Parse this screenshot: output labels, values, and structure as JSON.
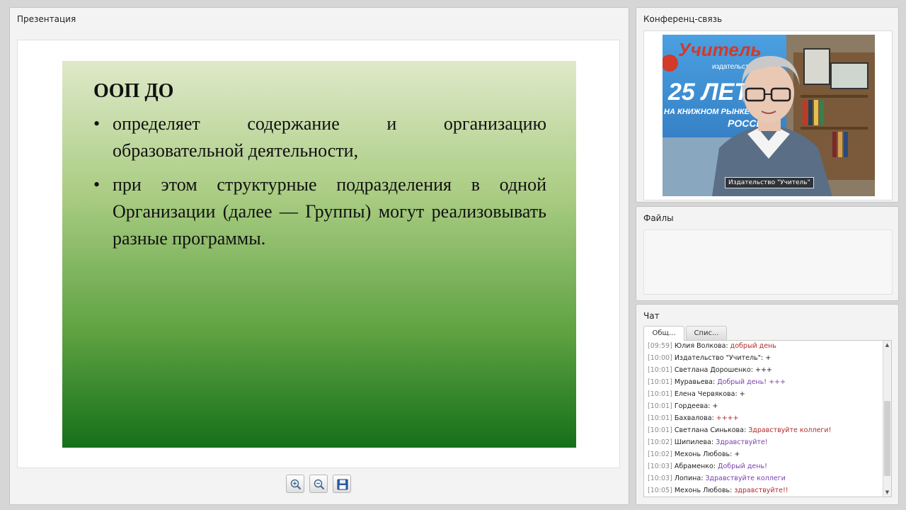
{
  "presentation": {
    "title": "Презентация",
    "slide": {
      "heading": "ООП ДО",
      "bullets": [
        "определяет содержание и организацию образовательной деятельности,",
        "при этом структурные подразделения в одной Организации (далее — Группы) могут реализовывать разные программы."
      ],
      "bullet_glyph": "•"
    },
    "toolbar": {
      "zoom_in": "zoom-in-icon",
      "zoom_out": "zoom-out-icon",
      "save": "save-icon"
    }
  },
  "conference": {
    "title": "Конференц-связь",
    "video_label": "Издательство \"Учитель\"",
    "backdrop_text": [
      "Учитель",
      "издательство",
      "25 ЛЕТ",
      "НА КНИЖНОМ РЫНКЕ",
      "РОССИИ"
    ]
  },
  "files": {
    "title": "Файлы"
  },
  "chat": {
    "title": "Чат",
    "tabs": [
      "Общ...",
      "Спис..."
    ],
    "messages": [
      {
        "time": "[09:59]",
        "author": "Юлия Волкова:",
        "text": "добрый день",
        "color": "#b22a2a"
      },
      {
        "time": "[10:00]",
        "author": "Издательство \"Учитель\":",
        "text": "+",
        "color": "#222222"
      },
      {
        "time": "[10:01]",
        "author": "Светлана Дорошенко:",
        "text": "+++",
        "color": "#222222"
      },
      {
        "time": "[10:01]",
        "author": "Муравьева:",
        "text": "Добрый день! +++",
        "color": "#7a3fb0"
      },
      {
        "time": "[10:01]",
        "author": "Елена Червякова:",
        "text": "+",
        "color": "#222222"
      },
      {
        "time": "[10:01]",
        "author": "Гордеева:",
        "text": "+",
        "color": "#222222"
      },
      {
        "time": "[10:01]",
        "author": "Бахвалова:",
        "text": "++++",
        "color": "#b22a2a"
      },
      {
        "time": "[10:01]",
        "author": "Светлана Синькова:",
        "text": "Здравствуйте коллеги!",
        "color": "#b22a2a"
      },
      {
        "time": "[10:02]",
        "author": "Шипилева:",
        "text": "Здравствуйте!",
        "color": "#7a3fb0"
      },
      {
        "time": "[10:02]",
        "author": "Мехонь Любовь:",
        "text": "+",
        "color": "#222222"
      },
      {
        "time": "[10:03]",
        "author": "Абраменко:",
        "text": "Добрый день!",
        "color": "#7a3fb0"
      },
      {
        "time": "[10:03]",
        "author": "Лопина:",
        "text": "Здравствуйте коллеги",
        "color": "#7a3fb0"
      },
      {
        "time": "[10:05]",
        "author": "Мехонь Любовь:",
        "text": "здравствуйте!!",
        "color": "#b22a2a"
      }
    ]
  }
}
